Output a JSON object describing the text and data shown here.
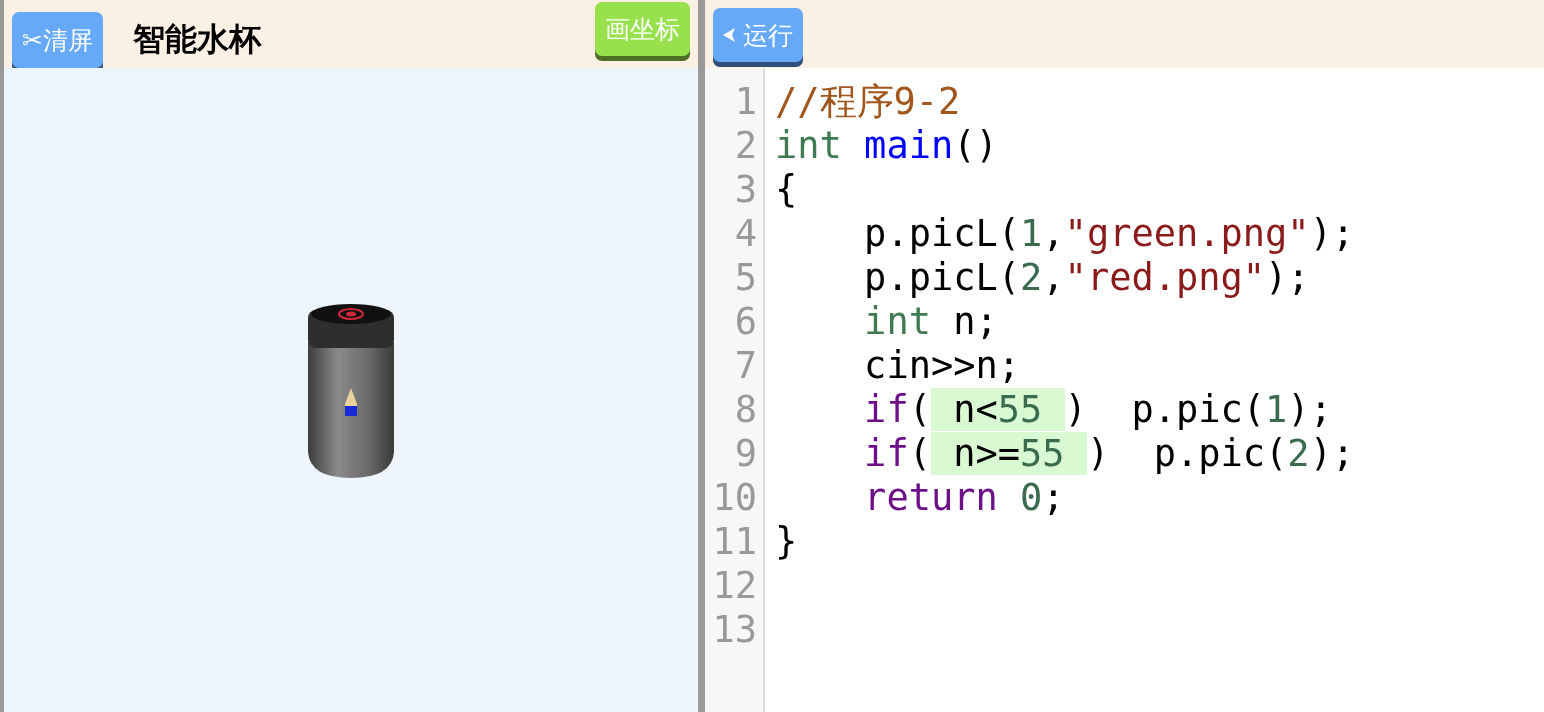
{
  "left_panel": {
    "clear_button": "✂清屏",
    "title": "智能水杯",
    "axes_button": "画坐标"
  },
  "right_panel": {
    "run_button": "运行",
    "code_lines": [
      {
        "number": "1",
        "tokens": [
          {
            "kind": "comment",
            "text": "//程序9-2"
          }
        ]
      },
      {
        "number": "2",
        "tokens": [
          {
            "kind": "type",
            "text": "int"
          },
          {
            "kind": "function",
            "text": " main"
          },
          {
            "kind": "plain",
            "text": "()"
          }
        ]
      },
      {
        "number": "3",
        "tokens": [
          {
            "kind": "plain",
            "text": "{"
          }
        ]
      },
      {
        "number": "4",
        "tokens": [
          {
            "kind": "plain",
            "text": "    p.picL("
          },
          {
            "kind": "number",
            "text": "1"
          },
          {
            "kind": "plain",
            "text": ","
          },
          {
            "kind": "string",
            "text": "\"green.png\""
          },
          {
            "kind": "plain",
            "text": ");"
          }
        ]
      },
      {
        "number": "5",
        "tokens": [
          {
            "kind": "plain",
            "text": "    p.picL("
          },
          {
            "kind": "number",
            "text": "2"
          },
          {
            "kind": "plain",
            "text": ","
          },
          {
            "kind": "string",
            "text": "\"red.png\""
          },
          {
            "kind": "plain",
            "text": ");"
          }
        ]
      },
      {
        "number": "6",
        "tokens": [
          {
            "kind": "type",
            "text": "    int"
          },
          {
            "kind": "plain",
            "text": " n;"
          }
        ]
      },
      {
        "number": "7",
        "tokens": [
          {
            "kind": "plain",
            "text": "    cin>>n;"
          }
        ]
      },
      {
        "number": "8",
        "tokens": [
          {
            "kind": "keyword",
            "text": "    if"
          },
          {
            "kind": "plain",
            "text": "("
          },
          {
            "kind": "input",
            "tokens": [
              {
                "kind": "plain",
                "text": " n<"
              },
              {
                "kind": "number",
                "text": "55 "
              }
            ]
          },
          {
            "kind": "plain",
            "text": ")  p.pic("
          },
          {
            "kind": "number",
            "text": "1"
          },
          {
            "kind": "plain",
            "text": ");"
          }
        ]
      },
      {
        "number": "9",
        "tokens": [
          {
            "kind": "keyword",
            "text": "    if"
          },
          {
            "kind": "plain",
            "text": "("
          },
          {
            "kind": "input",
            "tokens": [
              {
                "kind": "plain",
                "text": " n>="
              },
              {
                "kind": "number",
                "text": "55 "
              }
            ]
          },
          {
            "kind": "plain",
            "text": ")  p.pic("
          },
          {
            "kind": "number",
            "text": "2"
          },
          {
            "kind": "plain",
            "text": ");"
          }
        ]
      },
      {
        "number": "10",
        "tokens": [
          {
            "kind": "keyword",
            "text": "    return"
          },
          {
            "kind": "number",
            "text": " 0"
          },
          {
            "kind": "plain",
            "text": ";"
          }
        ]
      },
      {
        "number": "11",
        "tokens": [
          {
            "kind": "plain",
            "text": "}"
          }
        ]
      },
      {
        "number": "12"
      },
      {
        "number": "13"
      }
    ]
  }
}
